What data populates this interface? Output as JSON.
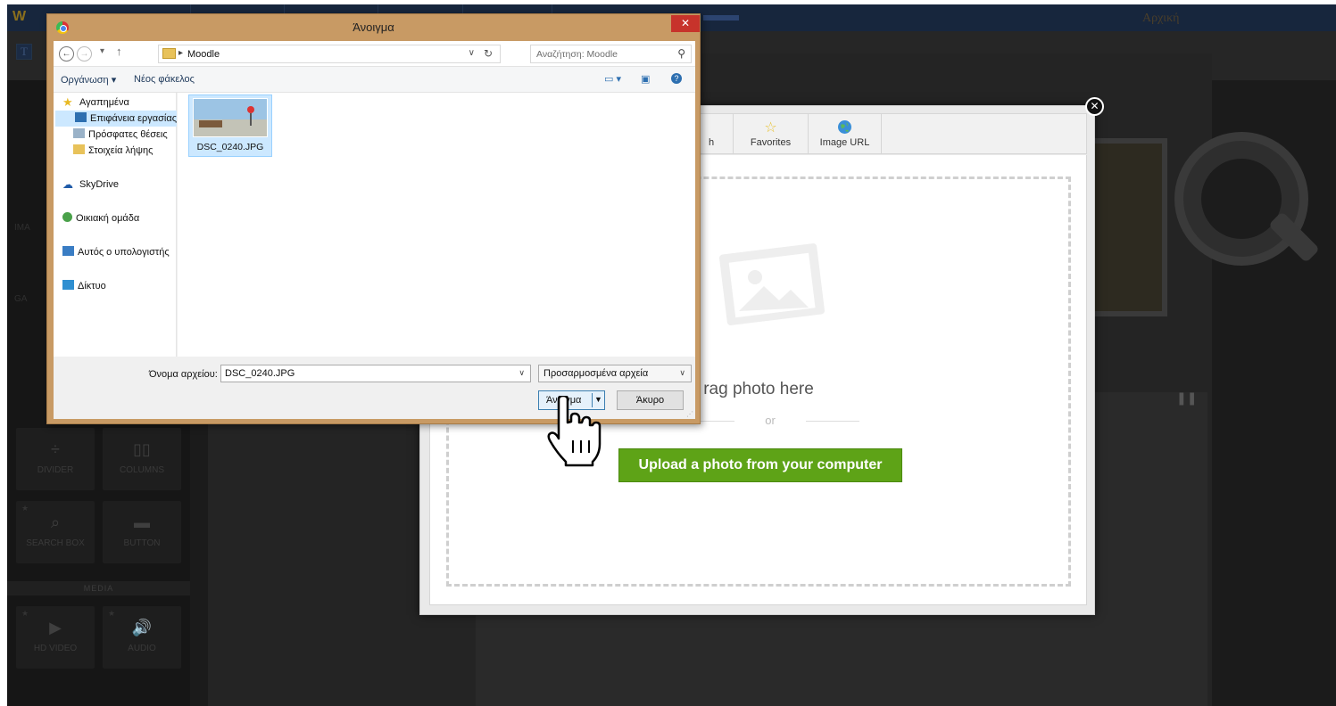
{
  "editor": {
    "home_link": "Αρχική",
    "sidebar_sections": [
      "MEDIA"
    ],
    "widgets": [
      {
        "label": "DIVIDER",
        "icon": "divider-icon",
        "glyph": "÷"
      },
      {
        "label": "COLUMNS",
        "icon": "columns-icon",
        "glyph": "▯▯"
      },
      {
        "label": "SEARCH BOX",
        "icon": "search-icon",
        "glyph": "⌕"
      },
      {
        "label": "BUTTON",
        "icon": "button-icon",
        "glyph": "▬"
      },
      {
        "label": "HD VIDEO",
        "icon": "video-icon",
        "glyph": "▶"
      },
      {
        "label": "AUDIO",
        "icon": "audio-icon",
        "glyph": "🔊"
      }
    ],
    "peek_labels": [
      "IMA",
      "GA"
    ]
  },
  "picker": {
    "tabs": [
      {
        "label": "h",
        "icon": "search-icon"
      },
      {
        "label": "Favorites",
        "icon": "star-icon"
      },
      {
        "label": "Image URL",
        "icon": "globe-icon"
      }
    ],
    "drag_text": "rag photo here",
    "or_text": "or",
    "upload_label": "Upload a photo from your computer",
    "upload_color": "#5ea317"
  },
  "dialog": {
    "title": "Άνοιγμα",
    "close_glyph": "✕",
    "address_path": "Moodle",
    "search_placeholder": "Αναζήτηση: Moodle",
    "toolbar": {
      "organize": "Οργάνωση ▾",
      "new_folder": "Νέος φάκελος"
    },
    "nav": {
      "favorites": "Αγαπημένα",
      "desktop": "Επιφάνεια εργασίας",
      "recent": "Πρόσφατες θέσεις",
      "downloads": "Στοιχεία λήψης",
      "skydrive": "SkyDrive",
      "homegroup": "Οικιακή ομάδα",
      "computer": "Αυτός ο υπολογιστής",
      "network": "Δίκτυο"
    },
    "files": [
      {
        "name": "DSC_0240.JPG",
        "selected": true
      }
    ],
    "filename_label": "Όνομα αρχείου:",
    "filename_value": "DSC_0240.JPG",
    "filter_value": "Προσαρμοσμένα αρχεία",
    "open_label": "Άνοιγμα",
    "cancel_label": "Άκυρο"
  }
}
